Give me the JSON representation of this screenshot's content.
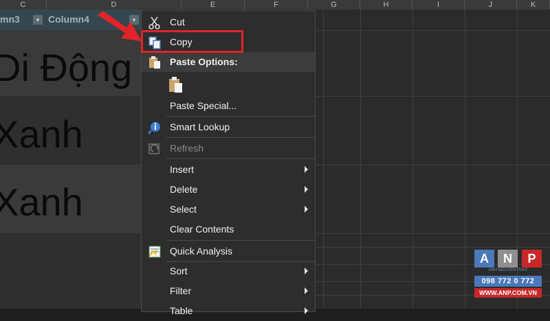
{
  "columns": {
    "c": "C",
    "d": "D",
    "e": "E",
    "f": "F",
    "g": "G",
    "h": "H",
    "i": "I",
    "j": "J",
    "k": "K"
  },
  "table": {
    "col3": "mn3",
    "col4": "Column4",
    "filter_glyph": "▾",
    "rows": [
      "Di  Động",
      "Xanh",
      "Xanh"
    ]
  },
  "menu": {
    "cut": "Cut",
    "copy": "Copy",
    "paste_options": "Paste Options:",
    "paste_special": "Paste Special...",
    "smart_lookup": "Smart Lookup",
    "refresh": "Refresh",
    "insert": "Insert",
    "delete": "Delete",
    "select": "Select",
    "clear_contents": "Clear Contents",
    "quick_analysis": "Quick Analysis",
    "sort": "Sort",
    "filter": "Filter",
    "table": "Table"
  },
  "logo": {
    "a": "A",
    "n": "N",
    "p": "P",
    "tagline": "ANH NGUYEN PHAT",
    "phone": "098 772 0 772",
    "web": "WWW.ANP.COM.VN"
  },
  "colors": {
    "highlight": "#e0242a",
    "arrow": "#e0242a",
    "menu_bg": "#2d2d2d"
  }
}
